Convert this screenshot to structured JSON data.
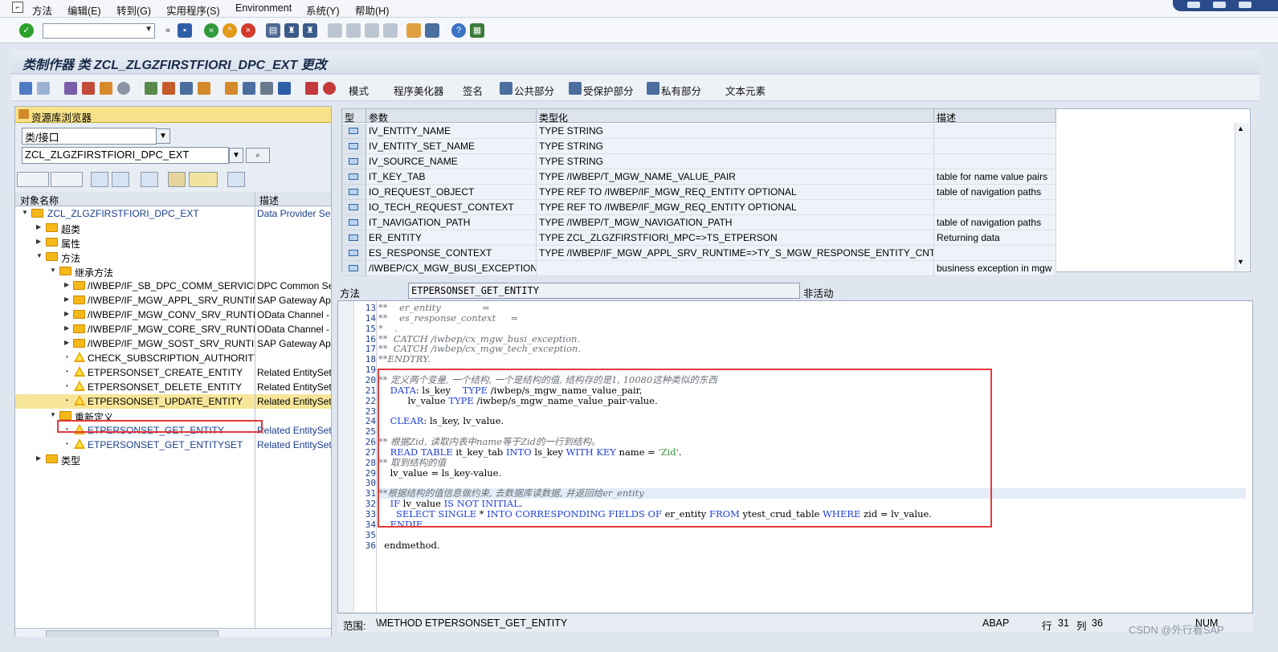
{
  "menu": [
    "方法",
    "编辑(E)",
    "转到(G)",
    "实用程序(S)",
    "Environment",
    "系统(Y)",
    "帮助(H)"
  ],
  "title": "类制作器 类 ZCL_ZLGZFIRSTFIORI_DPC_EXT 更改",
  "app_toolbar": [
    "模式",
    "程序美化器",
    "签名",
    "公共部分",
    "受保护部分",
    "私有部分",
    "文本元素"
  ],
  "repo": {
    "header": "资源库浏览器",
    "type_value": "类/接口",
    "name_value": "ZCL_ZLGZFIRSTFIORI_DPC_EXT",
    "col_name": "对象名称",
    "col_desc": "描述",
    "tree": [
      {
        "name": "ZCL_ZLGZFIRSTFIORI_DPC_EXT",
        "desc": "Data Provider Sec"
      },
      {
        "name": "超类",
        "desc": ""
      },
      {
        "name": "属性",
        "desc": ""
      },
      {
        "name": "方法",
        "desc": ""
      },
      {
        "name": "继承方法",
        "desc": ""
      },
      {
        "name": "/IWBEP/IF_SB_DPC_COMM_SERVICES",
        "desc": "DPC Common Ser"
      },
      {
        "name": "/IWBEP/IF_MGW_APPL_SRV_RUNTIM",
        "desc": "SAP Gateway Ap"
      },
      {
        "name": "/IWBEP/IF_MGW_CONV_SRV_RUNTIM",
        "desc": "OData Channel -"
      },
      {
        "name": "/IWBEP/IF_MGW_CORE_SRV_RUNTIM",
        "desc": "OData Channel -"
      },
      {
        "name": "/IWBEP/IF_MGW_SOST_SRV_RUNTIM",
        "desc": "SAP Gateway Ap"
      },
      {
        "name": "CHECK_SUBSCRIPTION_AUTHORITY",
        "desc": ""
      },
      {
        "name": "ETPERSONSET_CREATE_ENTITY",
        "desc": "Related EntitySet"
      },
      {
        "name": "ETPERSONSET_DELETE_ENTITY",
        "desc": "Related EntitySet"
      },
      {
        "name": "ETPERSONSET_UPDATE_ENTITY",
        "desc": "Related EntitySet"
      },
      {
        "name": "重新定义",
        "desc": ""
      },
      {
        "name": "ETPERSONSET_GET_ENTITY",
        "desc": "Related EntitySet"
      },
      {
        "name": "ETPERSONSET_GET_ENTITYSET",
        "desc": "Related EntitySet"
      },
      {
        "name": "类型",
        "desc": ""
      }
    ]
  },
  "params": {
    "headers": [
      "型",
      "参数",
      "类型化",
      "描述"
    ],
    "rows": [
      {
        "param": "IV_ENTITY_NAME",
        "type": "TYPE STRING",
        "desc": ""
      },
      {
        "param": "IV_ENTITY_SET_NAME",
        "type": "TYPE STRING",
        "desc": ""
      },
      {
        "param": "IV_SOURCE_NAME",
        "type": "TYPE STRING",
        "desc": ""
      },
      {
        "param": "IT_KEY_TAB",
        "type": "TYPE /IWBEP/T_MGW_NAME_VALUE_PAIR",
        "desc": "table for name value pairs"
      },
      {
        "param": "IO_REQUEST_OBJECT",
        "type": "TYPE REF TO /IWBEP/IF_MGW_REQ_ENTITY OPTIONAL",
        "desc": "table of navigation paths"
      },
      {
        "param": "IO_TECH_REQUEST_CONTEXT",
        "type": "TYPE REF TO /IWBEP/IF_MGW_REQ_ENTITY OPTIONAL",
        "desc": ""
      },
      {
        "param": "IT_NAVIGATION_PATH",
        "type": "TYPE /IWBEP/T_MGW_NAVIGATION_PATH",
        "desc": "table of navigation paths"
      },
      {
        "param": "ER_ENTITY",
        "type": "TYPE ZCL_ZLGZFIRSTFIORI_MPC=>TS_ETPERSON",
        "desc": "Returning data"
      },
      {
        "param": "ES_RESPONSE_CONTEXT",
        "type": "TYPE /IWBEP/IF_MGW_APPL_SRV_RUNTIME=>TY_S_MGW_RESPONSE_ENTITY_CNTXT",
        "desc": ""
      },
      {
        "param": "/IWBEP/CX_MGW_BUSI_EXCEPTION",
        "type": "",
        "desc": "business exception in mgw"
      }
    ]
  },
  "method": {
    "label": "方法",
    "name": "ETPERSONSET_GET_ENTITY",
    "status": "非活动"
  },
  "code": [
    {
      "n": "13",
      "t": "**    er_entity              ="
    },
    {
      "n": "14",
      "t": "**    es_response_context     ="
    },
    {
      "n": "15",
      "t": "*    ."
    },
    {
      "n": "16",
      "t": "**  CATCH /iwbep/cx_mgw_busi_exception."
    },
    {
      "n": "17",
      "t": "**  CATCH /iwbep/cx_mgw_tech_exception."
    },
    {
      "n": "18",
      "t": "**ENDTRY."
    },
    {
      "n": "19",
      "t": ""
    },
    {
      "n": "20",
      "t": "** 定义两个变量, 一个结构, 一个是结构的值, 结构存的是1, 10080这种类似的东西"
    },
    {
      "n": "21",
      "t": "    DATA: ls_key    TYPE /iwbep/s_mgw_name_value_pair,"
    },
    {
      "n": "22",
      "t": "          lv_value TYPE /iwbep/s_mgw_name_value_pair-value."
    },
    {
      "n": "23",
      "t": ""
    },
    {
      "n": "24",
      "t": "    CLEAR: ls_key, lv_value."
    },
    {
      "n": "25",
      "t": ""
    },
    {
      "n": "26",
      "t": "** 根据Zid, 读取内表中name等于Zid的一行到结构。"
    },
    {
      "n": "27",
      "t": "    READ TABLE it_key_tab INTO ls_key WITH KEY name = 'Zid'."
    },
    {
      "n": "28",
      "t": "** 取到结构的值"
    },
    {
      "n": "29",
      "t": "    lv_value = ls_key-value."
    },
    {
      "n": "30",
      "t": ""
    },
    {
      "n": "31",
      "t": "**根据结构的值信息做约束, 去数据库读数据, 并返回给er_entity"
    },
    {
      "n": "32",
      "t": "    IF lv_value IS NOT INITIAL."
    },
    {
      "n": "33",
      "t": "      SELECT SINGLE * INTO CORRESPONDING FIELDS OF er_entity FROM ytest_crud_table WHERE zid = lv_value."
    },
    {
      "n": "34",
      "t": "    ENDIF."
    },
    {
      "n": "35",
      "t": ""
    },
    {
      "n": "36",
      "t": "  endmethod."
    }
  ],
  "status": {
    "scope_label": "范围:",
    "scope_value": "\\METHOD ETPERSONSET_GET_ENTITY",
    "lang": "ABAP",
    "line_label": "行",
    "line": "31",
    "col_label": "列",
    "col": "36",
    "num": "NUM"
  },
  "watermark": "CSDN @外行看SAP"
}
